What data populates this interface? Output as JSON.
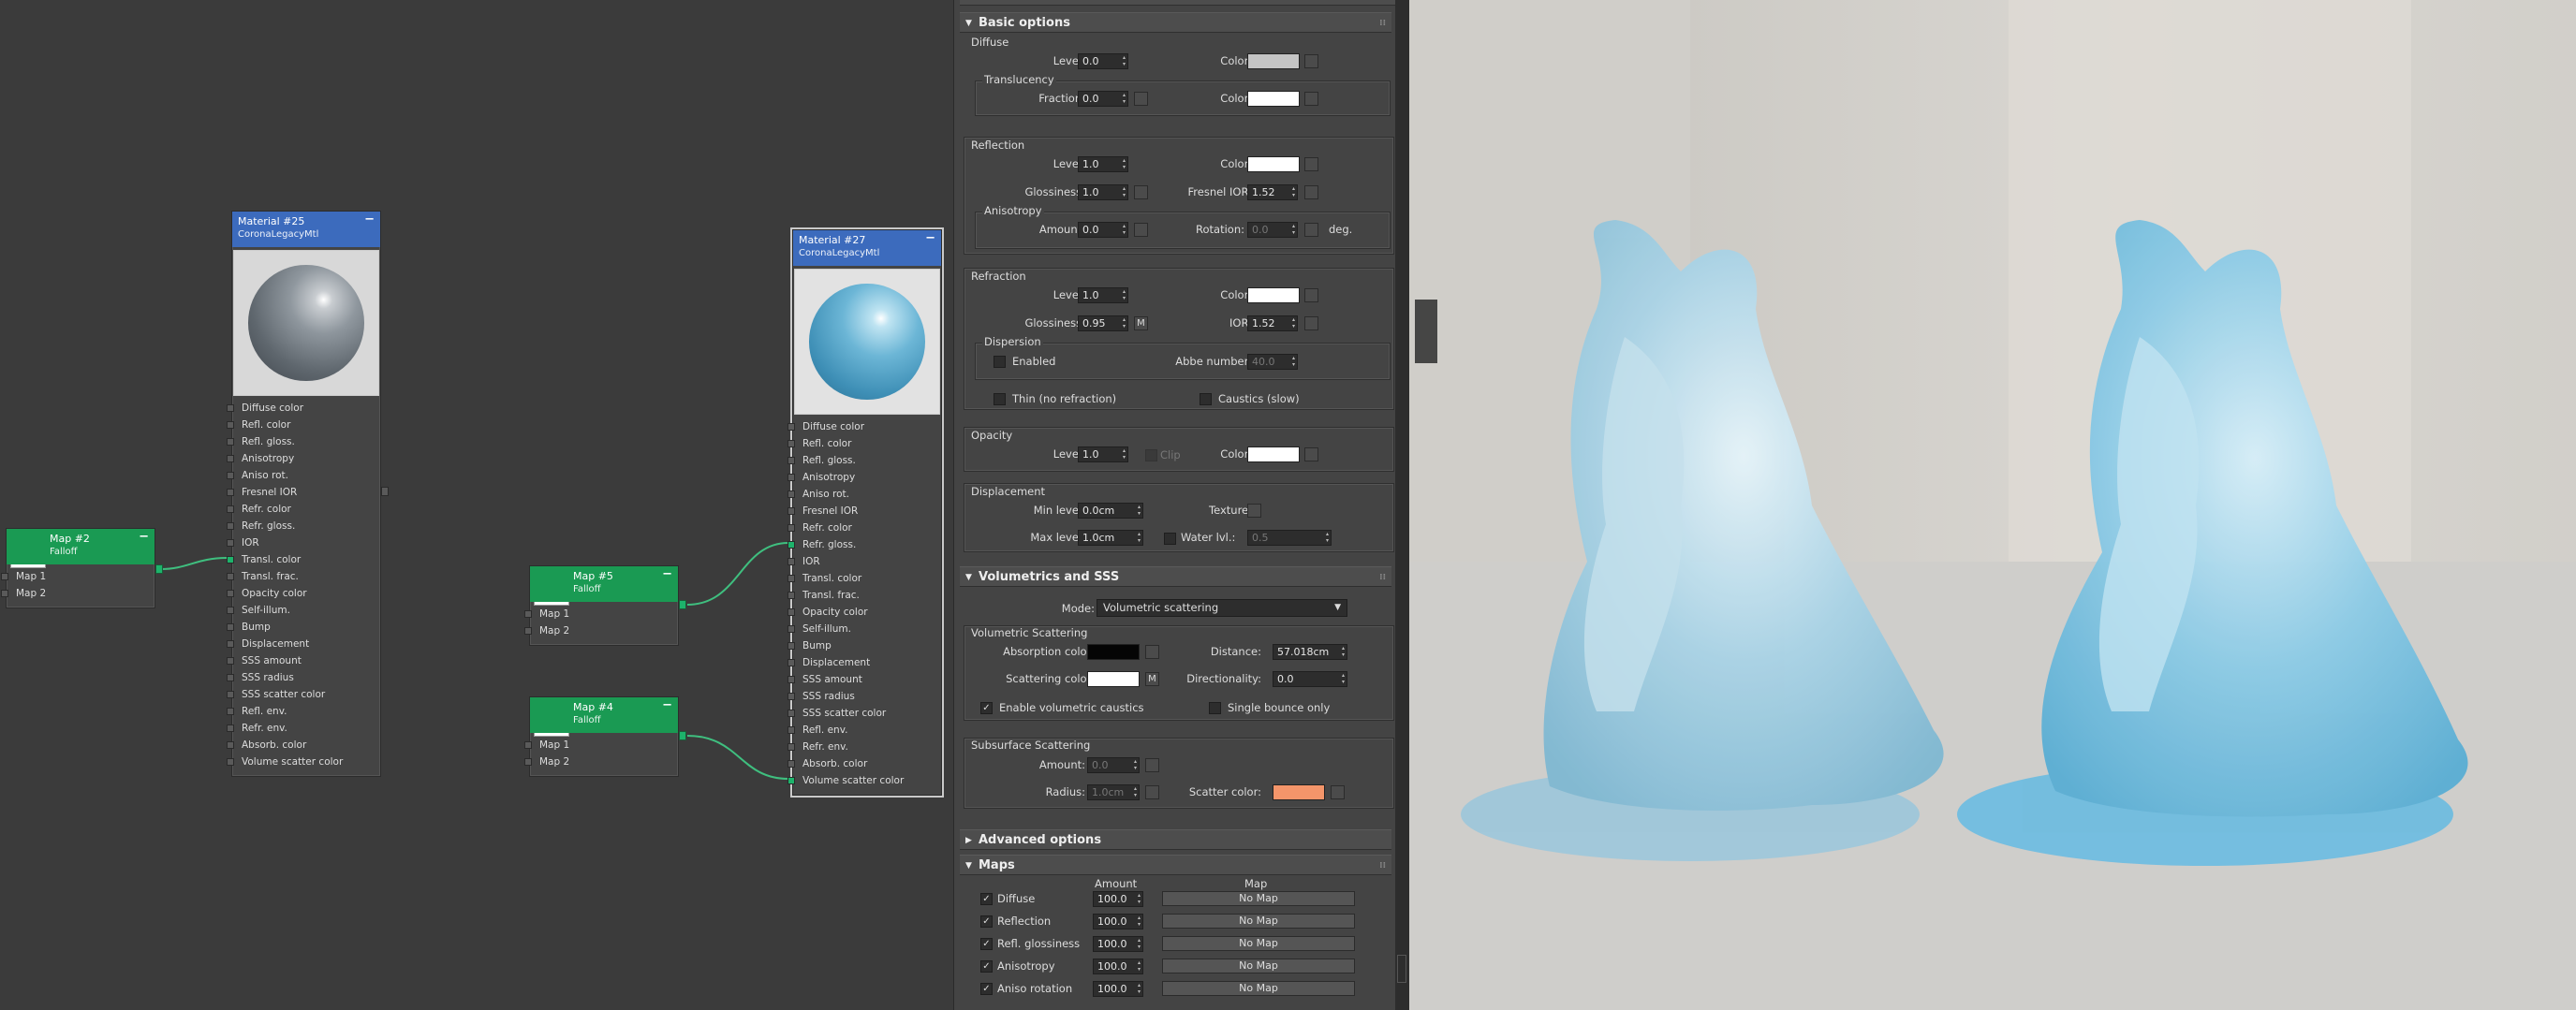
{
  "nodes": {
    "material25": {
      "title": "Material #25",
      "subtitle": "CoronaLegacyMtl",
      "slots": [
        "Diffuse color",
        "Refl. color",
        "Refl. gloss.",
        "Anisotropy",
        "Aniso rot.",
        "Fresnel IOR",
        "Refr. color",
        "Refr. gloss.",
        "IOR",
        "Transl. color",
        "Transl. frac.",
        "Opacity color",
        "Self-illum.",
        "Bump",
        "Displacement",
        "SSS amount",
        "SSS radius",
        "SSS scatter color",
        "Refl. env.",
        "Refr. env.",
        "Absorb. color",
        "Volume scatter color"
      ]
    },
    "material27": {
      "title": "Material #27",
      "subtitle": "CoronaLegacyMtl",
      "slots": [
        "Diffuse color",
        "Refl. color",
        "Refl. gloss.",
        "Anisotropy",
        "Aniso rot.",
        "Fresnel IOR",
        "Refr. color",
        "Refr. gloss.",
        "IOR",
        "Transl. color",
        "Transl. frac.",
        "Opacity color",
        "Self-illum.",
        "Bump",
        "Displacement",
        "SSS amount",
        "SSS radius",
        "SSS scatter color",
        "Refl. env.",
        "Refr. env.",
        "Absorb. color",
        "Volume scatter color"
      ]
    },
    "map2": {
      "title": "Map #2",
      "subtitle": "Falloff",
      "slots": [
        "Map 1",
        "Map 2"
      ]
    },
    "map5": {
      "title": "Map #5",
      "subtitle": "Falloff",
      "slots": [
        "Map 1",
        "Map 2"
      ]
    },
    "map4": {
      "title": "Map #4",
      "subtitle": "Falloff",
      "slots": [
        "Map 1",
        "Map 2"
      ]
    },
    "collapse_symbol": "−"
  },
  "panel": {
    "basic": {
      "title": "Basic options",
      "diffuse": {
        "group": "Diffuse",
        "level_label": "Level:",
        "level": "0.0",
        "color_label": "Color:",
        "color": "#c4c4c4"
      },
      "translucency": {
        "group": "Translucency",
        "fraction_label": "Fraction:",
        "fraction": "0.0",
        "color_label": "Color:",
        "color": "#ffffff"
      },
      "reflection": {
        "group": "Reflection",
        "level_label": "Level:",
        "level": "1.0",
        "color_label": "Color:",
        "color": "#ffffff",
        "gloss_label": "Glossiness:",
        "gloss": "1.0",
        "fresnel_label": "Fresnel IOR:",
        "fresnel": "1.52"
      },
      "anisotropy": {
        "group": "Anisotropy",
        "amount_label": "Amount:",
        "amount": "0.0",
        "rotation_label": "Rotation:",
        "rotation": "0.0",
        "deg": "deg."
      },
      "refraction": {
        "group": "Refraction",
        "level_label": "Level:",
        "level": "1.0",
        "color_label": "Color:",
        "color": "#ffffff",
        "gloss_label": "Glossiness:",
        "gloss": "0.95",
        "m": "M",
        "ior_label": "IOR:",
        "ior": "1.52"
      },
      "dispersion": {
        "group": "Dispersion",
        "enabled_label": "Enabled",
        "abbe_label": "Abbe number:",
        "abbe": "40.0"
      },
      "thin_label": "Thin (no refraction)",
      "caustics_label": "Caustics (slow)",
      "opacity": {
        "group": "Opacity",
        "level_label": "Level:",
        "level": "1.0",
        "clip_label": "Clip",
        "color_label": "Color:",
        "color": "#ffffff"
      },
      "displacement": {
        "group": "Displacement",
        "min_label": "Min level:",
        "min": "0.0cm",
        "texture_label": "Texture:",
        "max_label": "Max level:",
        "max": "1.0cm",
        "water_label": "Water lvl.:",
        "water": "0.5"
      }
    },
    "volumetrics": {
      "title": "Volumetrics and SSS",
      "mode_label": "Mode:",
      "mode": "Volumetric scattering",
      "group": "Volumetric Scattering",
      "absorption_label": "Absorption color:",
      "absorption_color": "#050505",
      "distance_label": "Distance:",
      "distance": "57.018cm",
      "scattering_label": "Scattering color:",
      "scattering_color": "#ffffff",
      "m": "M",
      "directionality_label": "Directionality:",
      "directionality": "0.0",
      "caustics_label": "Enable volumetric caustics",
      "single_label": "Single bounce only",
      "sss_group": "Subsurface Scattering",
      "amount_label": "Amount:",
      "amount": "0.0",
      "radius_label": "Radius:",
      "radius": "1.0cm",
      "scatter_label": "Scatter color:",
      "scatter_color": "#f4956a"
    },
    "advanced": {
      "title": "Advanced options"
    },
    "maps": {
      "title": "Maps",
      "amount_header": "Amount",
      "map_header": "Map",
      "rows": [
        {
          "name": "Diffuse",
          "amount": "100.0",
          "map": "No Map"
        },
        {
          "name": "Reflection",
          "amount": "100.0",
          "map": "No Map"
        },
        {
          "name": "Refl. glossiness",
          "amount": "100.0",
          "map": "No Map"
        },
        {
          "name": "Anisotropy",
          "amount": "100.0",
          "map": "No Map"
        },
        {
          "name": "Aniso rotation",
          "amount": "100.0",
          "map": "No Map"
        }
      ]
    },
    "check_mark": "✓",
    "tri_open": "▼",
    "tri_closed": "▶",
    "pin": "⁞⁞"
  },
  "colors": {
    "material_header": "#3c6bbd",
    "map_header": "#1a9a53",
    "socket_active": "#1db36b",
    "wire": "#3fbf7f"
  }
}
